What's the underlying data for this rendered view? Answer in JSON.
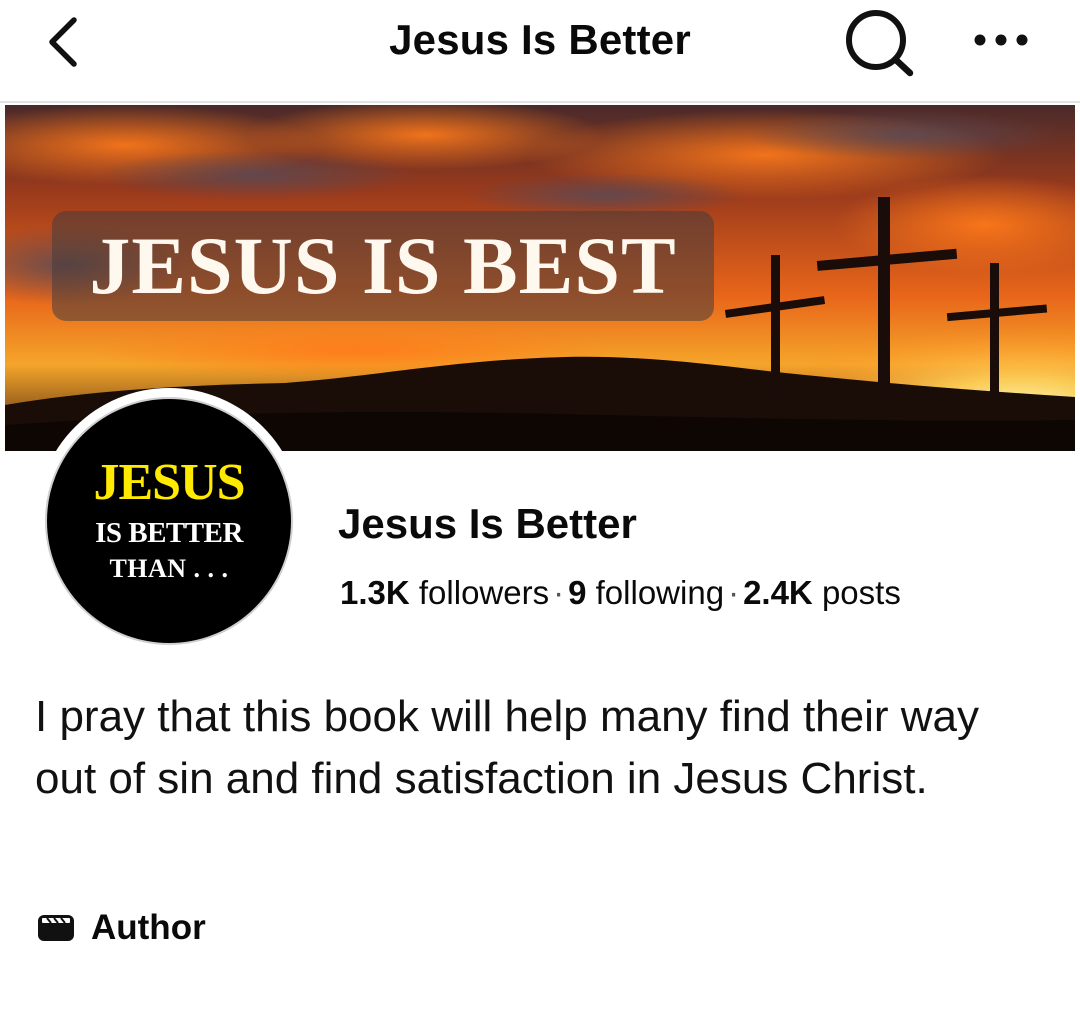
{
  "header": {
    "title": "Jesus Is Better",
    "back_icon": "back-arrow-icon",
    "search_icon": "search-icon",
    "more_icon": "more-options-icon"
  },
  "cover": {
    "text": "JESUS IS BEST"
  },
  "avatar": {
    "line1": "JESUS",
    "line2": "IS BETTER",
    "line3": "THAN . . ."
  },
  "profile": {
    "name": "Jesus Is Better",
    "followers_count": "1.3K",
    "followers_label": "followers",
    "following_count": "9",
    "following_label": "following",
    "posts_count": "2.4K",
    "posts_label": "posts",
    "separator": "·"
  },
  "bio": "I pray that this book will help many find their way out of sin and find satisfaction in Jesus Christ.",
  "category": {
    "label": "Author",
    "icon": "clapperboard-icon"
  },
  "colors": {
    "avatar_accent": "#ffea00",
    "sky_orange": "#e8651a"
  }
}
